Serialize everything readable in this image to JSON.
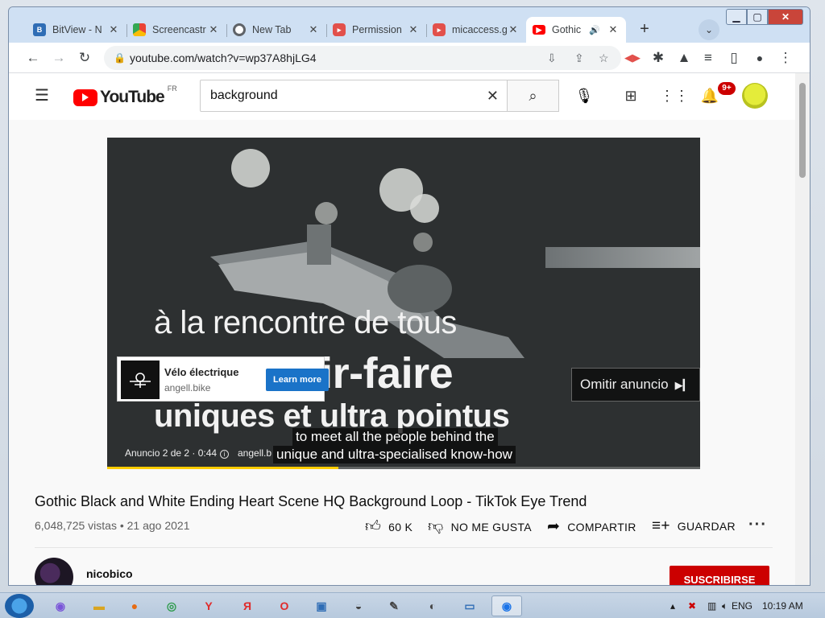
{
  "browser": {
    "tabs": [
      {
        "title": "BitView - N",
        "favicon": "bitview-favicon",
        "color": "#2f6db5"
      },
      {
        "title": "Screencastr",
        "favicon": "screencast-favicon",
        "color": "#e8a33a"
      },
      {
        "title": "New Tab",
        "favicon": "chrome-favicon",
        "color": "#5f6368"
      },
      {
        "title": "Permission",
        "favicon": "screencastify-favicon",
        "color": "#e2504b"
      },
      {
        "title": "micaccess.g",
        "favicon": "screencastify-favicon",
        "color": "#e2504b"
      },
      {
        "title": "Gothic",
        "favicon": "youtube-favicon",
        "color": "#ff0000",
        "active": true
      }
    ],
    "url": "youtube.com/watch?v=wp37A8hjLG4"
  },
  "youtube": {
    "logo_text": "YouTube",
    "region": "FR",
    "search_value": "background",
    "notification_count": "9+"
  },
  "player": {
    "caption_lines": [
      "à la rencontre de tous",
      "les savoir-faire",
      "uniques et ultra pointus"
    ],
    "ad": {
      "name": "Vélo électrique",
      "domain": "angell.bike",
      "cta": "Learn more",
      "info": "Anuncio 2 de 2 · 0:44",
      "site_short": "angell.b"
    },
    "skip_label": "Omitir anuncio",
    "subtitles": [
      "to meet all the people behind the",
      "unique and ultra-specialised know-how"
    ],
    "progress": 0.39,
    "progress_color": "#ffcc00"
  },
  "video": {
    "title": "Gothic Black and White Ending Heart Scene HQ Background Loop - TikTok Eye Trend",
    "meta": "6,048,725 vistas • 21 ago 2021",
    "actions": {
      "like": "60 K",
      "dislike": "NO ME GUSTA",
      "share": "COMPARTIR",
      "save": "GUARDAR"
    }
  },
  "channel": {
    "name": "nicobico",
    "subscribe": "SUSCRIBIRSE"
  },
  "taskbar": {
    "lang": "ENG",
    "time": "10:19 AM"
  },
  "colors": {
    "brand_red": "#ff0000",
    "subscribe_red": "#cc0000",
    "learn_more_blue": "#1a73c8"
  }
}
